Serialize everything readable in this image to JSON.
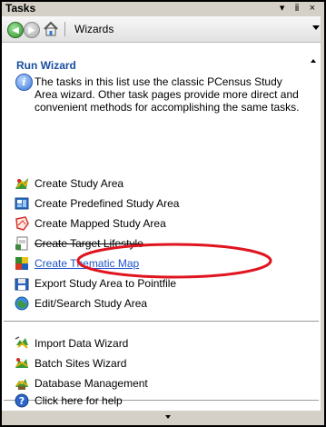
{
  "pane": {
    "title": "Tasks",
    "title_buttons": "▾ ⅱ ×"
  },
  "toolbar": {
    "back_icon": "back-arrow-icon",
    "forward_icon": "forward-arrow-icon",
    "home_icon": "home-icon",
    "breadcrumb": "Wizards"
  },
  "section": {
    "title": "Run Wizard",
    "info_text": "The tasks in this list use the classic PCensus Study Area wizard.  Other task pages provide more direct and convenient methods for accomplishing the same tasks."
  },
  "groups": [
    {
      "items": [
        {
          "label": "Create Study Area",
          "icon": "study-area-icon"
        },
        {
          "label": "Create Predefined Study Area",
          "icon": "predefined-area-icon"
        },
        {
          "label": "Create Mapped Study Area",
          "icon": "mapped-area-icon"
        },
        {
          "label": "Create Target Lifestyle",
          "icon": "target-lifestyle-icon"
        },
        {
          "label": "Create Thematic Map",
          "icon": "thematic-map-icon"
        },
        {
          "label": "Export Study Area to Pointfile",
          "icon": "export-pointfile-icon"
        },
        {
          "label": "Edit/Search Study Area",
          "icon": "edit-search-icon"
        }
      ]
    },
    {
      "items": [
        {
          "label": "Import Data Wizard",
          "icon": "import-data-icon"
        },
        {
          "label": "Batch Sites Wizard",
          "icon": "batch-sites-icon"
        },
        {
          "label": "Database Management",
          "icon": "database-icon"
        }
      ]
    },
    {
      "items": [
        {
          "label": "Click here for help",
          "icon": "help-icon"
        }
      ]
    }
  ],
  "colors": {
    "link": "#1f54c6",
    "section_title": "#1a4fa0",
    "annotation": "#e0141e"
  }
}
